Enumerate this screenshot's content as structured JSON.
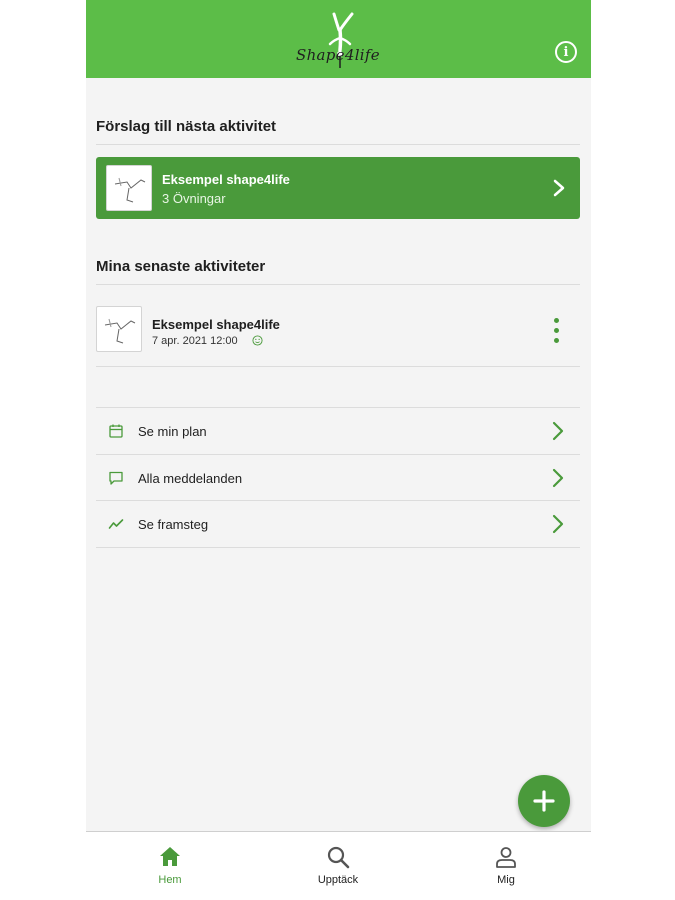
{
  "header": {
    "logo_text": "Shape4life",
    "logo_icon": "gymnast-handstand-logo",
    "info_icon": "info-icon",
    "brand_color": "#5cbd48",
    "accent_color": "#4a9a3b"
  },
  "suggestions": {
    "title": "Förslag till nästa aktivitet",
    "card": {
      "title": "Eksempel shape4life",
      "subtitle": "3 Övningar",
      "icon": "chevron-right-icon"
    }
  },
  "recent": {
    "title": "Mina senaste aktiviteter",
    "items": [
      {
        "title": "Eksempel shape4life",
        "date": "7 apr. 2021 12:00",
        "mood_icon": "smiley-icon",
        "menu_icon": "more-vertical-icon"
      }
    ]
  },
  "menu": [
    {
      "label": "Se min plan",
      "icon": "calendar-icon"
    },
    {
      "label": "Alla meddelanden",
      "icon": "message-icon"
    },
    {
      "label": "Se framsteg",
      "icon": "trend-icon"
    }
  ],
  "fab": {
    "icon": "plus-icon"
  },
  "tabs": [
    {
      "label": "Hem",
      "icon": "home-icon",
      "active": true
    },
    {
      "label": "Upptäck",
      "icon": "search-icon",
      "active": false
    },
    {
      "label": "Mig",
      "icon": "person-icon",
      "active": false
    }
  ]
}
